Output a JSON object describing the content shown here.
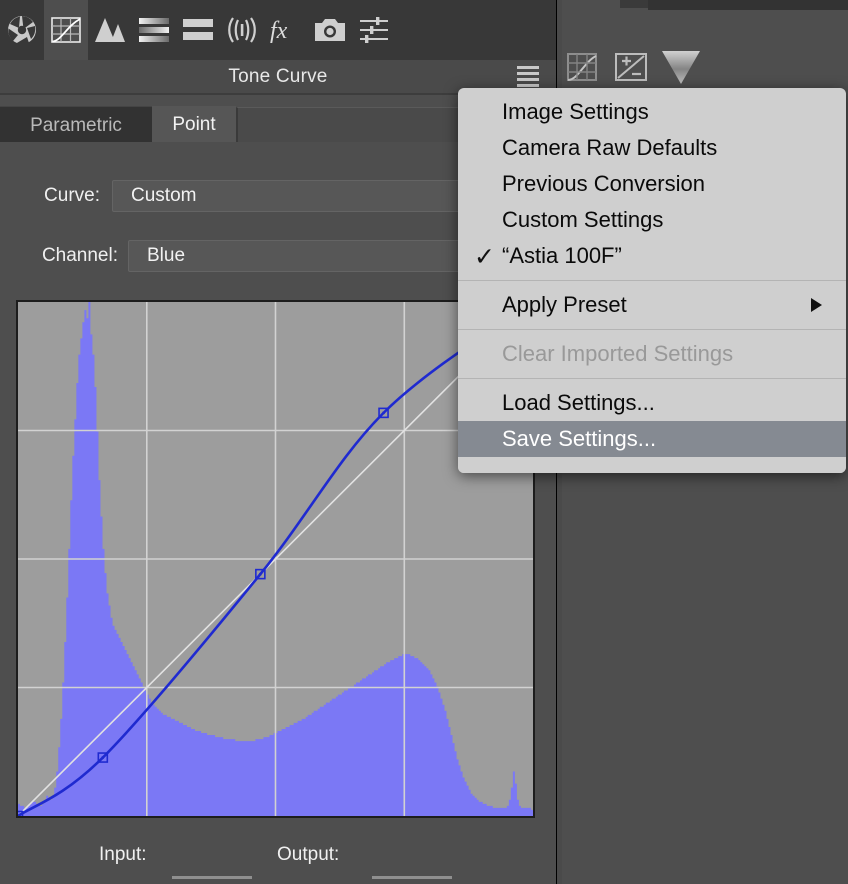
{
  "app": {
    "panel_title": "Tone Curve"
  },
  "toolbar": {
    "icons": [
      {
        "name": "aperture-icon",
        "label": "Basic",
        "active": false
      },
      {
        "name": "tone-curve-icon",
        "label": "Tone Curve",
        "active": true
      },
      {
        "name": "detail-icon",
        "label": "Detail",
        "active": false
      },
      {
        "name": "hsl-grayscale-icon",
        "label": "HSL / Grayscale",
        "active": false
      },
      {
        "name": "split-toning-icon",
        "label": "Split Toning",
        "active": false
      },
      {
        "name": "lens-corrections-icon",
        "label": "Lens Corrections",
        "active": false
      },
      {
        "name": "effects-fx-icon",
        "label": "Effects",
        "active": false
      },
      {
        "name": "camera-calibration-icon",
        "label": "Camera Calibration",
        "active": false
      },
      {
        "name": "presets-sliders-icon",
        "label": "Presets",
        "active": false
      }
    ],
    "menu_button": "panel-menu-icon"
  },
  "tabs": [
    {
      "label": "Parametric",
      "selected": false
    },
    {
      "label": "Point",
      "selected": true
    }
  ],
  "fields": {
    "curve_label": "Curve:",
    "curve_value": "Custom",
    "channel_label": "Channel:",
    "channel_value": "Blue"
  },
  "footer": {
    "input_label": "Input:",
    "output_label": "Output:",
    "input_value": "",
    "output_value": ""
  },
  "menu": {
    "items": [
      {
        "label": "Image Settings",
        "checked": false,
        "disabled": false,
        "selected": false,
        "submenu": false
      },
      {
        "label": "Camera Raw Defaults",
        "checked": false,
        "disabled": false,
        "selected": false,
        "submenu": false
      },
      {
        "label": "Previous Conversion",
        "checked": false,
        "disabled": false,
        "selected": false,
        "submenu": false
      },
      {
        "label": "Custom Settings",
        "checked": false,
        "disabled": false,
        "selected": false,
        "submenu": false
      },
      {
        "label": "“Astia 100F”",
        "checked": true,
        "disabled": false,
        "selected": false,
        "submenu": false
      },
      {
        "label": "Apply Preset",
        "checked": false,
        "disabled": false,
        "selected": false,
        "submenu": true
      },
      {
        "label": "Clear Imported Settings",
        "checked": false,
        "disabled": true,
        "selected": false,
        "submenu": false
      },
      {
        "label": "Load Settings...",
        "checked": false,
        "disabled": false,
        "selected": false,
        "submenu": false
      },
      {
        "label": "Save Settings...",
        "checked": false,
        "disabled": false,
        "selected": true,
        "submenu": false
      }
    ],
    "check_glyph": "✓"
  },
  "colors": {
    "panel_bg": "#4e4e4e",
    "toolbar_bg": "#383838",
    "graph_bg": "#9d9d9d",
    "grid_line": "#d2d2d2",
    "histogram_blue": "#7b78f5",
    "curve_blue": "#1f2ad0",
    "identity_line": "#e0e0e0",
    "menu_bg": "#cfcfcf",
    "menu_highlight": "#858a92",
    "menu_disabled_text": "#999999",
    "text": "#f0f0f0"
  },
  "chart_data": {
    "type": "area",
    "title": "Tone Curve - Blue channel",
    "xlabel": "Input",
    "ylabel": "Output",
    "xlim": [
      0,
      255
    ],
    "ylim": [
      0,
      255
    ],
    "grid": true,
    "grid_divisions": 4,
    "curve_points": [
      {
        "input": 0,
        "output": 0
      },
      {
        "input": 42,
        "output": 29
      },
      {
        "input": 120,
        "output": 120
      },
      {
        "input": 181,
        "output": 200
      },
      {
        "input": 255,
        "output": 255
      }
    ],
    "identity_line": [
      [
        0,
        0
      ],
      [
        255,
        255
      ]
    ],
    "histogram": [
      6,
      5,
      5,
      4,
      4,
      5,
      6,
      7,
      7,
      6,
      5,
      5,
      6,
      8,
      10,
      9,
      8,
      10,
      14,
      22,
      34,
      48,
      66,
      86,
      108,
      132,
      156,
      178,
      196,
      214,
      228,
      236,
      244,
      250,
      246,
      254,
      238,
      228,
      212,
      190,
      166,
      148,
      132,
      120,
      110,
      104,
      98,
      94,
      92,
      90,
      88,
      86,
      84,
      82,
      80,
      78,
      76,
      74,
      72,
      70,
      68,
      66,
      64,
      62,
      60,
      58,
      56,
      55,
      54,
      53,
      52,
      51,
      50,
      50,
      49,
      49,
      48,
      48,
      47,
      47,
      46,
      46,
      45,
      45,
      44,
      44,
      43,
      43,
      42,
      42,
      42,
      41,
      41,
      41,
      40,
      40,
      40,
      40,
      39,
      39,
      39,
      39,
      38,
      38,
      38,
      38,
      38,
      38,
      37,
      37,
      37,
      37,
      37,
      37,
      37,
      37,
      37,
      37,
      38,
      38,
      38,
      38,
      39,
      39,
      39,
      40,
      40,
      41,
      41,
      42,
      42,
      43,
      43,
      44,
      44,
      45,
      45,
      46,
      46,
      47,
      47,
      48,
      48,
      49,
      50,
      50,
      51,
      52,
      52,
      53,
      54,
      54,
      55,
      56,
      56,
      57,
      58,
      58,
      59,
      60,
      60,
      61,
      62,
      62,
      63,
      64,
      64,
      65,
      66,
      66,
      67,
      68,
      68,
      69,
      70,
      70,
      71,
      72,
      72,
      73,
      74,
      74,
      75,
      76,
      76,
      77,
      77,
      78,
      78,
      79,
      79,
      80,
      80,
      80,
      80,
      79,
      79,
      78,
      78,
      77,
      76,
      75,
      74,
      73,
      72,
      70,
      68,
      66,
      64,
      61,
      58,
      55,
      52,
      48,
      44,
      40,
      36,
      32,
      28,
      25,
      22,
      19,
      17,
      15,
      13,
      11,
      10,
      9,
      8,
      7,
      7,
      6,
      6,
      5,
      5,
      5,
      4,
      4,
      4,
      4,
      4,
      4,
      4,
      5,
      8,
      14,
      22,
      16,
      8,
      5,
      4,
      4,
      4,
      4,
      4,
      3
    ],
    "histogram_max": 254
  }
}
